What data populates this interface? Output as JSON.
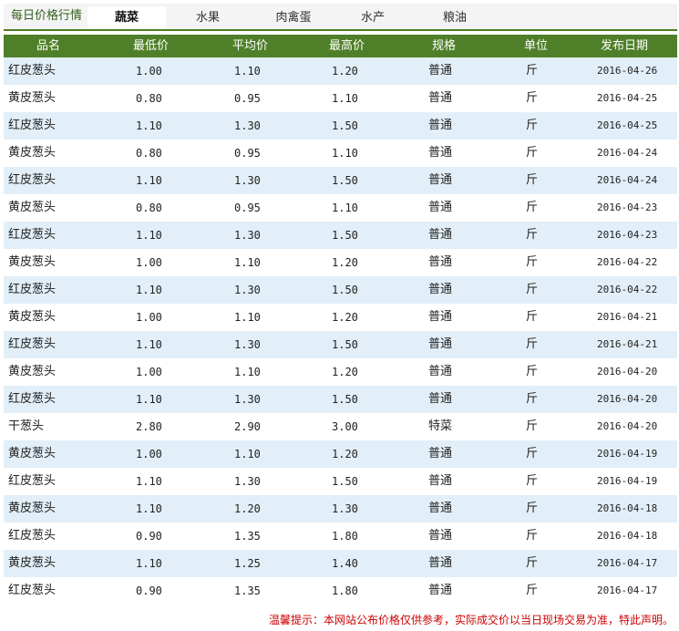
{
  "tabs": {
    "title": "每日价格行情",
    "items": [
      {
        "label": "蔬菜",
        "active": true
      },
      {
        "label": "水果",
        "active": false
      },
      {
        "label": "肉禽蛋",
        "active": false
      },
      {
        "label": "水产",
        "active": false
      },
      {
        "label": "粮油",
        "active": false
      }
    ]
  },
  "table": {
    "headers": [
      "品名",
      "最低价",
      "平均价",
      "最高价",
      "规格",
      "单位",
      "发布日期"
    ],
    "rows": [
      [
        "红皮葱头",
        "1.00",
        "1.10",
        "1.20",
        "普通",
        "斤",
        "2016-04-26"
      ],
      [
        "黄皮葱头",
        "0.80",
        "0.95",
        "1.10",
        "普通",
        "斤",
        "2016-04-25"
      ],
      [
        "红皮葱头",
        "1.10",
        "1.30",
        "1.50",
        "普通",
        "斤",
        "2016-04-25"
      ],
      [
        "黄皮葱头",
        "0.80",
        "0.95",
        "1.10",
        "普通",
        "斤",
        "2016-04-24"
      ],
      [
        "红皮葱头",
        "1.10",
        "1.30",
        "1.50",
        "普通",
        "斤",
        "2016-04-24"
      ],
      [
        "黄皮葱头",
        "0.80",
        "0.95",
        "1.10",
        "普通",
        "斤",
        "2016-04-23"
      ],
      [
        "红皮葱头",
        "1.10",
        "1.30",
        "1.50",
        "普通",
        "斤",
        "2016-04-23"
      ],
      [
        "黄皮葱头",
        "1.00",
        "1.10",
        "1.20",
        "普通",
        "斤",
        "2016-04-22"
      ],
      [
        "红皮葱头",
        "1.10",
        "1.30",
        "1.50",
        "普通",
        "斤",
        "2016-04-22"
      ],
      [
        "黄皮葱头",
        "1.00",
        "1.10",
        "1.20",
        "普通",
        "斤",
        "2016-04-21"
      ],
      [
        "红皮葱头",
        "1.10",
        "1.30",
        "1.50",
        "普通",
        "斤",
        "2016-04-21"
      ],
      [
        "黄皮葱头",
        "1.00",
        "1.10",
        "1.20",
        "普通",
        "斤",
        "2016-04-20"
      ],
      [
        "红皮葱头",
        "1.10",
        "1.30",
        "1.50",
        "普通",
        "斤",
        "2016-04-20"
      ],
      [
        "干葱头",
        "2.80",
        "2.90",
        "3.00",
        "特菜",
        "斤",
        "2016-04-20"
      ],
      [
        "黄皮葱头",
        "1.00",
        "1.10",
        "1.20",
        "普通",
        "斤",
        "2016-04-19"
      ],
      [
        "红皮葱头",
        "1.10",
        "1.30",
        "1.50",
        "普通",
        "斤",
        "2016-04-19"
      ],
      [
        "黄皮葱头",
        "1.10",
        "1.20",
        "1.30",
        "普通",
        "斤",
        "2016-04-18"
      ],
      [
        "红皮葱头",
        "0.90",
        "1.35",
        "1.80",
        "普通",
        "斤",
        "2016-04-18"
      ],
      [
        "黄皮葱头",
        "1.10",
        "1.25",
        "1.40",
        "普通",
        "斤",
        "2016-04-17"
      ],
      [
        "红皮葱头",
        "0.90",
        "1.35",
        "1.80",
        "普通",
        "斤",
        "2016-04-17"
      ]
    ]
  },
  "notice": "温馨提示：本网站公布价格仅供参考，实际成交价以当日现场交易为准，特此声明。",
  "colors": {
    "header_bg": "#4f8029",
    "row_stripe": "#e2eff8",
    "notice": "#cc0000"
  }
}
